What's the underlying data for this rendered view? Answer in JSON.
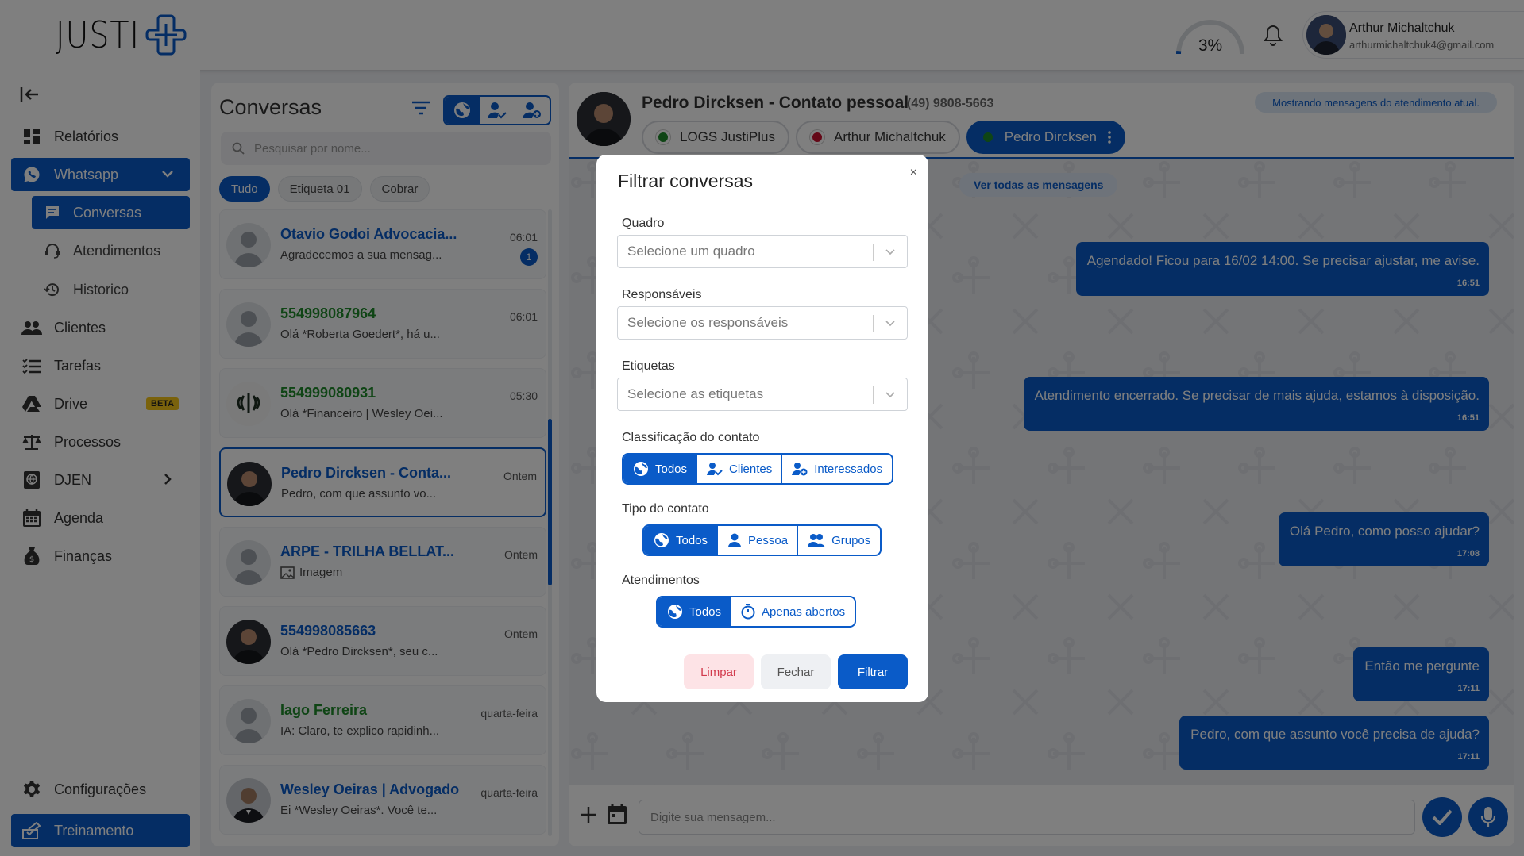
{
  "header": {
    "logo_text": "JUSTI",
    "progress_label": "3%",
    "progress_value": 0.03,
    "user_name": "Arthur Michaltchuk",
    "user_email": "arthurmichaltchuk4@gmail.com"
  },
  "sidebar": {
    "items": [
      {
        "label": "Relatórios",
        "icon": "dashboard-icon"
      },
      {
        "label": "Whatsapp",
        "icon": "whatsapp-icon"
      },
      {
        "label": "Conversas",
        "icon": "chat-icon"
      },
      {
        "label": "Atendimentos",
        "icon": "headset-icon"
      },
      {
        "label": "Historico",
        "icon": "history-icon"
      },
      {
        "label": "Clientes",
        "icon": "users-icon"
      },
      {
        "label": "Tarefas",
        "icon": "tasks-icon"
      },
      {
        "label": "Drive",
        "icon": "drive-icon",
        "badge": "BETA"
      },
      {
        "label": "Processos",
        "icon": "scale-icon"
      },
      {
        "label": "DJEN",
        "icon": "globe-icon"
      },
      {
        "label": "Agenda",
        "icon": "calendar-icon"
      },
      {
        "label": "Finanças",
        "icon": "money-bag-icon"
      },
      {
        "label": "Configurações",
        "icon": "gear-icon"
      },
      {
        "label": "Treinamento",
        "icon": "training-icon"
      }
    ]
  },
  "conversations": {
    "title": "Conversas",
    "search_placeholder": "Pesquisar por nome...",
    "chips": [
      "Tudo",
      "Etiqueta 01",
      "Cobrar"
    ],
    "items": [
      {
        "name": "Otavio Godoi Advocacia...",
        "preview": "Agradecemos a sua mensag...",
        "time": "06:01",
        "unread": "1",
        "color": "blue"
      },
      {
        "name": "554998087964",
        "preview": "Olá *Roberta Goedert*, há u...",
        "time": "06:01",
        "color": "green"
      },
      {
        "name": "554999080931",
        "preview": "Olá *Financeiro | Wesley Oei...",
        "time": "05:30",
        "color": "green"
      },
      {
        "name": "Pedro Dircksen - Conta...",
        "preview": "Pedro, com que assunto vo...",
        "time": "Ontem",
        "color": "blue",
        "selected": true
      },
      {
        "name": "ARPE - TRILHA BELLAT...",
        "preview": "Imagem",
        "time": "Ontem",
        "color": "blue"
      },
      {
        "name": "554998085663",
        "preview": "Olá *Pedro Dircksen*, seu c...",
        "time": "Ontem",
        "color": "blue"
      },
      {
        "name": "Iago Ferreira",
        "preview": "IA: Claro, te explico rapidinh...",
        "time": "quarta-feira",
        "color": "green"
      },
      {
        "name": "Wesley Oeiras | Advogado",
        "preview": "Ei *Wesley Oeiras*. Você te...",
        "time": "quarta-feira",
        "color": "blue"
      }
    ]
  },
  "chat": {
    "contact_name": "Pedro Dircksen - Contato pessoal",
    "contact_phone": "(49) 9808-5663",
    "notice": "Mostrando mensagens do atendimento atual.",
    "tabs": [
      "LOGS JustiPlus",
      "Arthur Michaltchuk",
      "Pedro Dircksen"
    ],
    "view_all": "Ver todas as mensagens",
    "messages": [
      {
        "text": "Agendado! Ficou para 16/02 14:00. Se precisar ajustar, me avise.",
        "time": "16:51"
      },
      {
        "text": "Atendimento encerrado. Se precisar de mais ajuda, estamos à disposição.",
        "time": "16:51"
      },
      {
        "text": "Olá Pedro, como posso ajudar?",
        "time": "17:08"
      },
      {
        "text": "Então me pergunte",
        "time": "17:11"
      },
      {
        "text": "Pedro, com que assunto você precisa de ajuda?",
        "time": "17:11"
      }
    ],
    "input_placeholder": "Digite sua mensagem..."
  },
  "modal": {
    "title": "Filtrar conversas",
    "close": "×",
    "quadro_label": "Quadro",
    "quadro_placeholder": "Selecione um quadro",
    "responsaveis_label": "Responsáveis",
    "responsaveis_placeholder": "Selecione os responsáveis",
    "etiquetas_label": "Etiquetas",
    "etiquetas_placeholder": "Selecione as etiquetas",
    "classificacao_label": "Classificação do contato",
    "classificacao_options": [
      "Todos",
      "Clientes",
      "Interessados"
    ],
    "tipo_label": "Tipo do contato",
    "tipo_options": [
      "Todos",
      "Pessoa",
      "Grupos"
    ],
    "atendimentos_label": "Atendimentos",
    "atendimentos_options": [
      "Todos",
      "Apenas abertos"
    ],
    "btn_clear": "Limpar",
    "btn_close": "Fechar",
    "btn_filter": "Filtrar"
  },
  "colors": {
    "primary": "#0a5bc8",
    "green": "#1f8a2b"
  }
}
